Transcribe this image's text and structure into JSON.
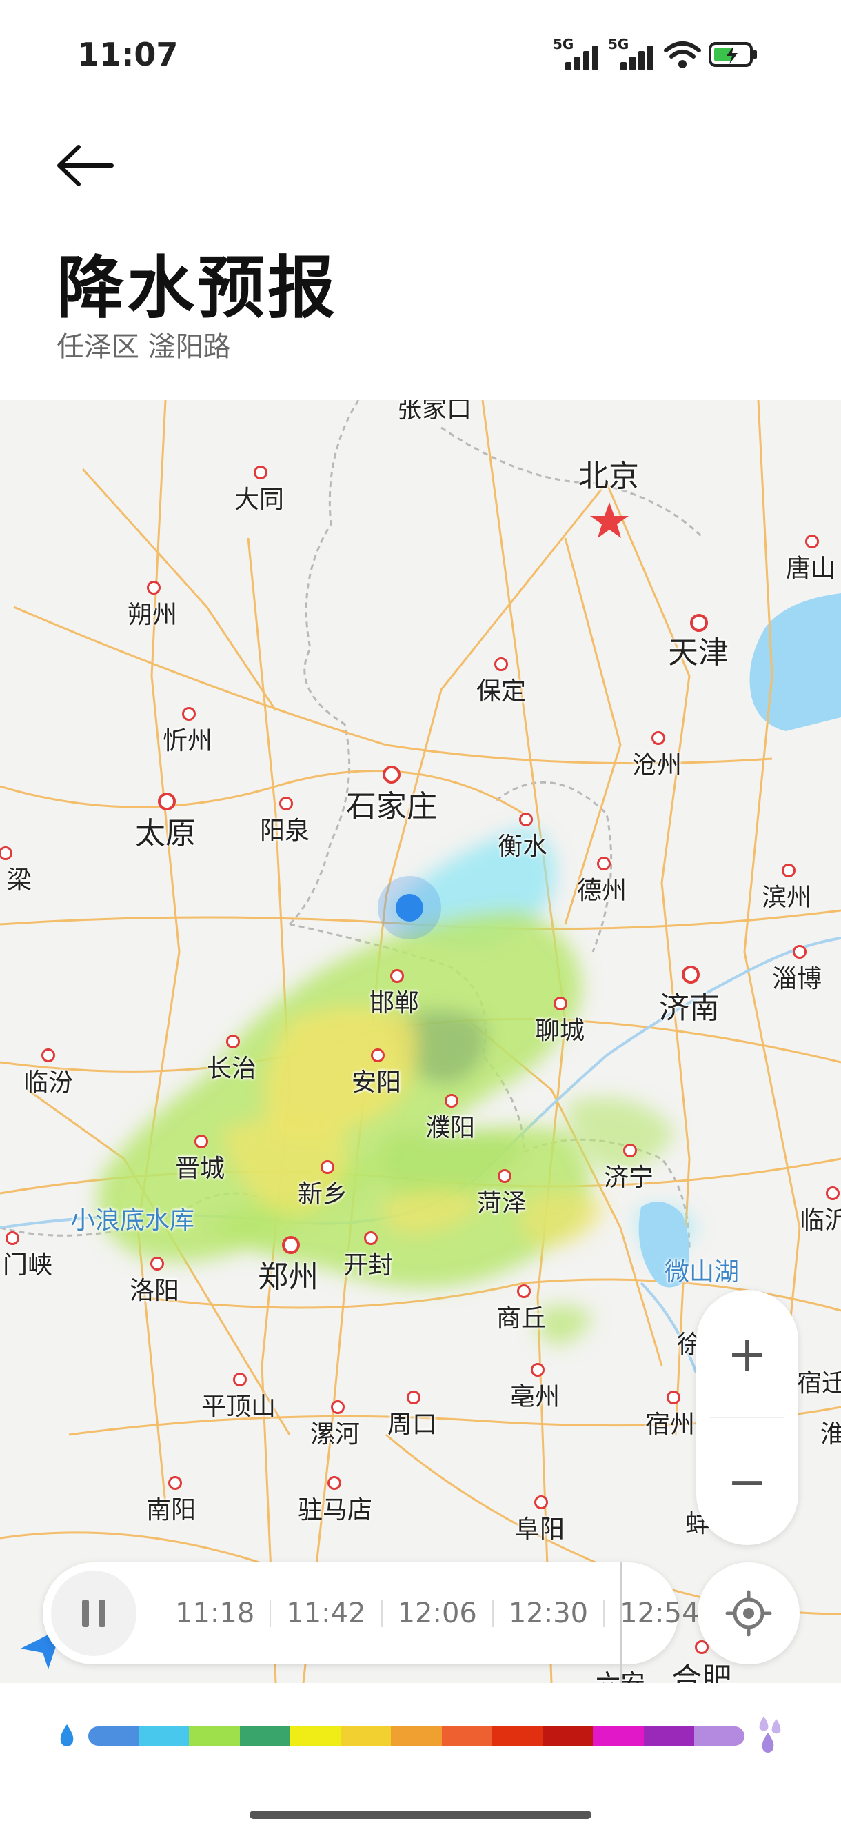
{
  "status_bar": {
    "time": "11:07",
    "signal1": "5G",
    "signal2": "5G"
  },
  "header": {
    "title": "降水预报",
    "subtitle": "任泽区 滏阳路"
  },
  "map": {
    "cities": [
      {
        "id": "beijing",
        "name": "北京",
        "size": "big",
        "capital": true
      },
      {
        "id": "tianjin",
        "name": "天津",
        "size": "big"
      },
      {
        "id": "tangshan",
        "name": "唐山"
      },
      {
        "id": "datong",
        "name": "大同"
      },
      {
        "id": "shuozhou",
        "name": "朔州"
      },
      {
        "id": "baoding",
        "name": "保定"
      },
      {
        "id": "cangzhou",
        "name": "沧州"
      },
      {
        "id": "xinzhou",
        "name": "忻州"
      },
      {
        "id": "taiyuan",
        "name": "太原",
        "size": "big"
      },
      {
        "id": "yangquan",
        "name": "阳泉"
      },
      {
        "id": "shijiazhuang",
        "name": "石家庄",
        "size": "big"
      },
      {
        "id": "hengshui",
        "name": "衡水"
      },
      {
        "id": "dezhou",
        "name": "德州"
      },
      {
        "id": "binzhou",
        "name": "滨州"
      },
      {
        "id": "liang",
        "name": "梁"
      },
      {
        "id": "zibo",
        "name": "淄博"
      },
      {
        "id": "jinan",
        "name": "济南",
        "size": "big"
      },
      {
        "id": "handan",
        "name": "邯郸"
      },
      {
        "id": "liaocheng",
        "name": "聊城"
      },
      {
        "id": "changzhi",
        "name": "长治"
      },
      {
        "id": "linfen",
        "name": "临汾"
      },
      {
        "id": "anyang",
        "name": "安阳"
      },
      {
        "id": "puyang",
        "name": "濮阳"
      },
      {
        "id": "jincheng",
        "name": "晋城"
      },
      {
        "id": "jining",
        "name": "济宁"
      },
      {
        "id": "xinxiang",
        "name": "新乡"
      },
      {
        "id": "heze",
        "name": "菏泽"
      },
      {
        "id": "xiaolangdi",
        "name": "小浪底水库",
        "type": "water"
      },
      {
        "id": "linyi",
        "name": "临沂"
      },
      {
        "id": "sanmenxia",
        "name": "门峡"
      },
      {
        "id": "zhengzhou",
        "name": "郑州",
        "size": "big"
      },
      {
        "id": "kaifeng",
        "name": "开封"
      },
      {
        "id": "weishanhu",
        "name": "微山湖",
        "type": "water"
      },
      {
        "id": "luoyang",
        "name": "洛阳"
      },
      {
        "id": "shangqiu",
        "name": "商丘"
      },
      {
        "id": "xu",
        "name": "徐"
      },
      {
        "id": "pingdingshan",
        "name": "平顶山"
      },
      {
        "id": "bozhou",
        "name": "亳州"
      },
      {
        "id": "suzhou_ah",
        "name": "宿州"
      },
      {
        "id": "suqian",
        "name": "宿迁"
      },
      {
        "id": "luohe",
        "name": "漯河"
      },
      {
        "id": "zhoukou",
        "name": "周口"
      },
      {
        "id": "huai",
        "name": "淮"
      },
      {
        "id": "nanyang",
        "name": "南阳"
      },
      {
        "id": "zhumadian",
        "name": "驻马店"
      },
      {
        "id": "fuyang",
        "name": "阜阳"
      },
      {
        "id": "bang",
        "name": "蚌"
      },
      {
        "id": "hefei",
        "name": "合肥"
      },
      {
        "id": "luan",
        "name": "六安"
      },
      {
        "id": "zhangjiakou",
        "name": "张家口"
      }
    ]
  },
  "zoom": {
    "in_label": "+",
    "out_label": "−"
  },
  "timeline": {
    "times": [
      "11:18",
      "11:42",
      "12:06",
      "12:30",
      "12:54"
    ]
  },
  "legend": {
    "colors": [
      "#4c8fe0",
      "#48c8ec",
      "#9ee04c",
      "#3aa56a",
      "#f0ec16",
      "#f2d030",
      "#f0a030",
      "#ee6030",
      "#e03010",
      "#c01810",
      "#e018c8",
      "#9a28b8",
      "#b48ae0"
    ],
    "accent": "#2a8ee6"
  }
}
